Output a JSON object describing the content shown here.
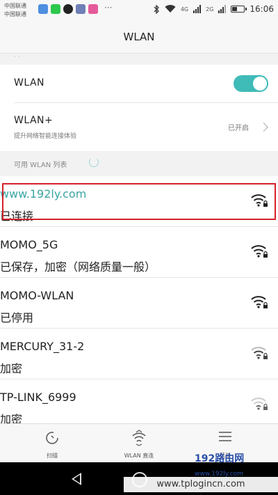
{
  "status_bar": {
    "carrier_line1": "中国联通",
    "carrier_line2": "中国联通",
    "net1": "4G",
    "net2": "2G",
    "dots": "···",
    "time": "16:06"
  },
  "title": "WLAN",
  "peek_text": "· ·",
  "wlan_toggle": {
    "label": "WLAN",
    "on": true
  },
  "wlan_plus": {
    "label": "WLAN+",
    "sub": "提升网络智能连接体验",
    "status": "已开启"
  },
  "available_header": "可用 WLAN 列表",
  "networks": [
    {
      "ssid": "www.192ly.com",
      "status": "已连接"
    },
    {
      "ssid": "MOMO_5G",
      "status": "已保存，加密（网络质量一般）"
    },
    {
      "ssid": "MOMO-WLAN",
      "status": "已停用"
    },
    {
      "ssid": "MERCURY_31-2",
      "status": "加密"
    },
    {
      "ssid": "TP-LINK_6999",
      "status": "加密"
    }
  ],
  "bottom_tabs": [
    {
      "label": "扫描",
      "icon": "refresh-icon"
    },
    {
      "label": "WLAN 直连",
      "icon": "wifi-direct-icon"
    },
    {
      "label": "菜单",
      "icon": "menu-icon"
    }
  ],
  "watermark": {
    "logo_text": "192路由网",
    "logo_url": "www.192ly.com",
    "site": "www.tplogincn.com"
  },
  "colors": {
    "accent": "#3fbbb8",
    "highlight": "#d4202b"
  }
}
